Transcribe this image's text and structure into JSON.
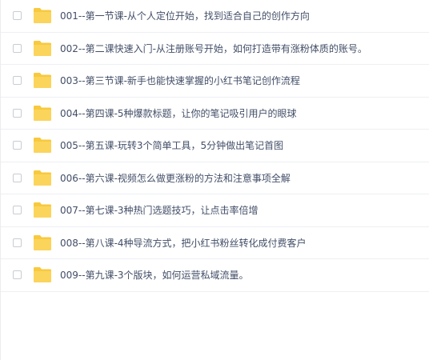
{
  "file_list": {
    "item_icon": "folder-icon",
    "folder_color": "#f8c93e",
    "items": [
      {
        "name": "001--第一节课-从个人定位开始，找到适合自己的创作方向"
      },
      {
        "name": "002--第二课快速入门-从注册账号开始，如何打造带有涨粉体质的账号。"
      },
      {
        "name": "003--第三节课-新手也能快速掌握的小红书笔记创作流程"
      },
      {
        "name": "004--第四课-5种爆款标题，让你的笔记吸引用户的眼球"
      },
      {
        "name": "005--第五课-玩转3个简单工具，5分钟做出笔记首图"
      },
      {
        "name": "006--第六课-视频怎么做更涨粉的方法和注意事项全解"
      },
      {
        "name": "007--第七课-3种热门选题技巧，让点击率倍增"
      },
      {
        "name": "008--第八课-4种导流方式，把小红书粉丝转化成付费客户"
      },
      {
        "name": "009--第九课-3个版块，如何运营私域流量。"
      }
    ]
  }
}
